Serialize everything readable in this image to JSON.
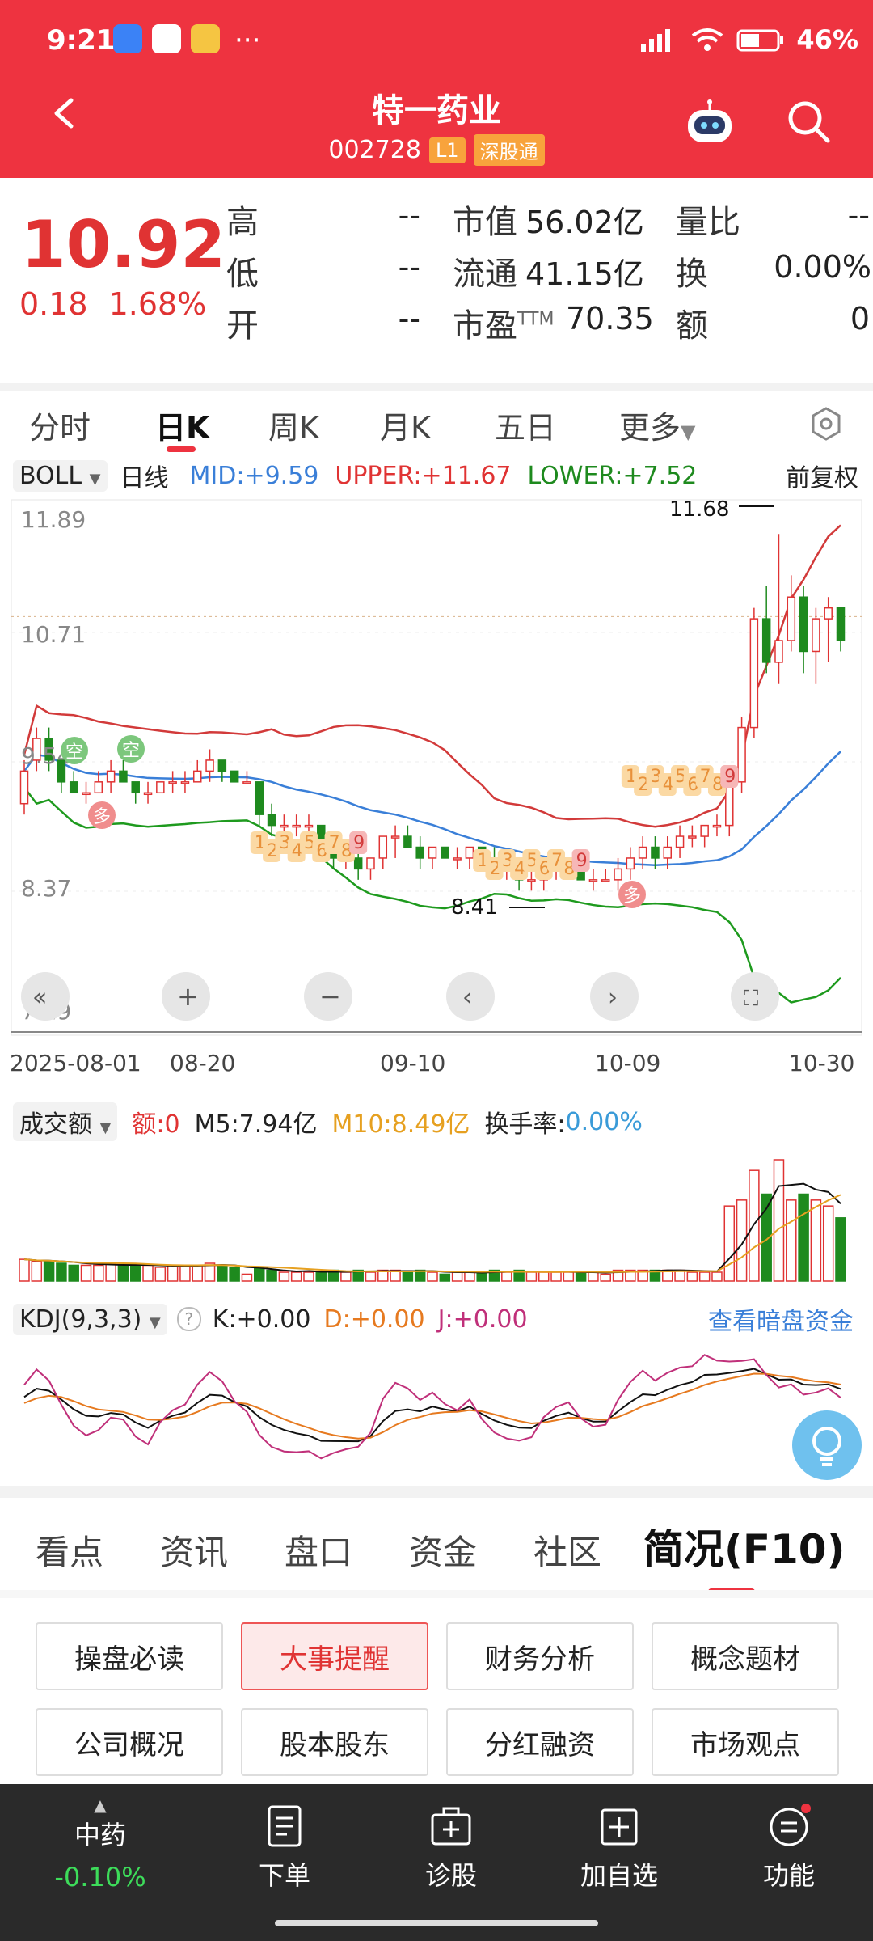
{
  "status_bar": {
    "time": "9:21",
    "dots": "···",
    "battery": "46%"
  },
  "header": {
    "title": "特一药业",
    "code": "002728",
    "level": "L1",
    "exchange": "深股通"
  },
  "quote": {
    "price": "10.92",
    "change": "0.18",
    "change_pct": "1.68%",
    "fields": [
      {
        "label": "高",
        "value": "--"
      },
      {
        "label": "市值",
        "value": "56.02亿"
      },
      {
        "label": "量比",
        "value": "--"
      },
      {
        "label": "低",
        "value": "--"
      },
      {
        "label": "流通",
        "value": "41.15亿"
      },
      {
        "label": "换",
        "value": "0.00%"
      },
      {
        "label": "开",
        "value": "--"
      },
      {
        "label": "市盈",
        "sup": "TTM",
        "value": "70.35"
      },
      {
        "label": "额",
        "value": "0"
      }
    ]
  },
  "ktabs": [
    "分时",
    "日K",
    "周K",
    "月K",
    "五日",
    "更多"
  ],
  "boll": {
    "selector": "BOLL",
    "period": "日线",
    "mid": "MID:+9.59",
    "upper": "UPPER:+11.67",
    "lower": "LOWER:+7.52",
    "adjust": "前复权"
  },
  "chart_data": {
    "type": "candlestick",
    "y_ticks": [
      "11.89",
      "10.71",
      "9.54",
      "8.37",
      "7.19"
    ],
    "x_labels": [
      "2025-08-01",
      "08-20",
      "09-10",
      "10-09",
      "10-30"
    ],
    "annotations": {
      "high": "11.68",
      "low": "8.41"
    },
    "signals": {
      "kong": "空",
      "duo": "多"
    },
    "seq1": [
      "1",
      "2",
      "3",
      "4",
      "5",
      "6",
      "7",
      "8",
      "9"
    ],
    "seq2": [
      "1",
      "2",
      "3",
      "4",
      "5",
      "6",
      "7",
      "8",
      "9"
    ],
    "seq3": [
      "1",
      "2",
      "3",
      "4",
      "5",
      "6",
      "7",
      "8",
      "9"
    ],
    "ohlc": [
      [
        9.2,
        9.6,
        9.1,
        9.5
      ],
      [
        9.6,
        9.9,
        9.5,
        9.8
      ],
      [
        9.8,
        9.9,
        9.5,
        9.6
      ],
      [
        9.6,
        9.6,
        9.3,
        9.4
      ],
      [
        9.4,
        9.5,
        9.3,
        9.3
      ],
      [
        9.3,
        9.4,
        9.2,
        9.3
      ],
      [
        9.3,
        9.5,
        9.3,
        9.4
      ],
      [
        9.4,
        9.6,
        9.3,
        9.5
      ],
      [
        9.5,
        9.6,
        9.4,
        9.4
      ],
      [
        9.4,
        9.4,
        9.2,
        9.3
      ],
      [
        9.3,
        9.4,
        9.2,
        9.3
      ],
      [
        9.3,
        9.4,
        9.3,
        9.4
      ],
      [
        9.4,
        9.5,
        9.3,
        9.4
      ],
      [
        9.4,
        9.5,
        9.3,
        9.4
      ],
      [
        9.4,
        9.6,
        9.4,
        9.5
      ],
      [
        9.5,
        9.7,
        9.4,
        9.6
      ],
      [
        9.6,
        9.6,
        9.4,
        9.5
      ],
      [
        9.5,
        9.5,
        9.4,
        9.4
      ],
      [
        9.4,
        9.5,
        9.4,
        9.4
      ],
      [
        9.4,
        9.4,
        9.0,
        9.1
      ],
      [
        9.1,
        9.2,
        8.9,
        9.0
      ],
      [
        9.0,
        9.1,
        8.9,
        9.0
      ],
      [
        9.0,
        9.1,
        8.9,
        9.0
      ],
      [
        9.0,
        9.1,
        8.9,
        9.0
      ],
      [
        9.0,
        9.0,
        8.8,
        8.8
      ],
      [
        8.8,
        8.9,
        8.6,
        8.7
      ],
      [
        8.7,
        8.8,
        8.6,
        8.7
      ],
      [
        8.7,
        8.8,
        8.5,
        8.6
      ],
      [
        8.6,
        8.7,
        8.5,
        8.7
      ],
      [
        8.7,
        8.9,
        8.6,
        8.9
      ],
      [
        8.9,
        9.0,
        8.7,
        8.9
      ],
      [
        8.9,
        9.0,
        8.8,
        8.8
      ],
      [
        8.8,
        8.9,
        8.6,
        8.7
      ],
      [
        8.7,
        8.8,
        8.6,
        8.8
      ],
      [
        8.8,
        8.8,
        8.7,
        8.7
      ],
      [
        8.7,
        8.8,
        8.6,
        8.7
      ],
      [
        8.7,
        8.8,
        8.6,
        8.8
      ],
      [
        8.8,
        8.8,
        8.6,
        8.7
      ],
      [
        8.7,
        8.8,
        8.5,
        8.6
      ],
      [
        8.6,
        8.7,
        8.5,
        8.6
      ],
      [
        8.6,
        8.7,
        8.4,
        8.5
      ],
      [
        8.5,
        8.6,
        8.4,
        8.5
      ],
      [
        8.5,
        8.6,
        8.4,
        8.6
      ],
      [
        8.6,
        8.7,
        8.5,
        8.6
      ],
      [
        8.6,
        8.7,
        8.5,
        8.6
      ],
      [
        8.6,
        8.7,
        8.5,
        8.5
      ],
      [
        8.5,
        8.6,
        8.4,
        8.5
      ],
      [
        8.5,
        8.6,
        8.5,
        8.5
      ],
      [
        8.5,
        8.7,
        8.4,
        8.6
      ],
      [
        8.6,
        8.8,
        8.5,
        8.7
      ],
      [
        8.7,
        8.9,
        8.6,
        8.8
      ],
      [
        8.8,
        8.9,
        8.6,
        8.7
      ],
      [
        8.7,
        8.9,
        8.6,
        8.8
      ],
      [
        8.8,
        9.0,
        8.7,
        8.9
      ],
      [
        8.9,
        9.0,
        8.8,
        8.9
      ],
      [
        8.9,
        9.0,
        8.8,
        9.0
      ],
      [
        9.0,
        9.1,
        8.9,
        9.0
      ],
      [
        9.0,
        9.5,
        8.9,
        9.4
      ],
      [
        9.4,
        10.0,
        9.3,
        9.9
      ],
      [
        9.9,
        11.0,
        9.8,
        10.9
      ],
      [
        10.9,
        11.2,
        10.4,
        10.5
      ],
      [
        10.5,
        11.68,
        10.3,
        10.7
      ],
      [
        10.7,
        11.3,
        10.6,
        11.1
      ],
      [
        11.1,
        11.2,
        10.4,
        10.6
      ],
      [
        10.6,
        11.0,
        10.3,
        10.9
      ],
      [
        10.9,
        11.1,
        10.5,
        11.0
      ],
      [
        11.0,
        11.0,
        10.6,
        10.7
      ]
    ],
    "volume": {
      "selector": "成交额",
      "amount_label": "额:0",
      "m5": "M5:7.94亿",
      "m10": "M10:8.49亿",
      "turnover_label": "换手率:",
      "turnover": "0.00%"
    },
    "kdj": {
      "selector": "KDJ(9,3,3)",
      "help": "?",
      "k": "K:+0.00",
      "d": "D:+0.00",
      "j": "J:+0.00",
      "link": "查看暗盘资金"
    }
  },
  "bottom_tabs": [
    "看点",
    "资讯",
    "盘口",
    "资金",
    "社区",
    "简况(F10)"
  ],
  "grid_buttons": [
    "操盘必读",
    "大事提醒",
    "财务分析",
    "概念题材",
    "公司概况",
    "股本股东",
    "分红融资",
    "市场观点"
  ],
  "bottom_nav": {
    "sector": "中药",
    "sector_chg": "-0.10%",
    "items": [
      "下单",
      "诊股",
      "加自选",
      "功能"
    ]
  },
  "colors": {
    "header": "#ee3340",
    "up": "#e03333",
    "down": "#1e8a1e",
    "mid": "#3a7fd8"
  }
}
